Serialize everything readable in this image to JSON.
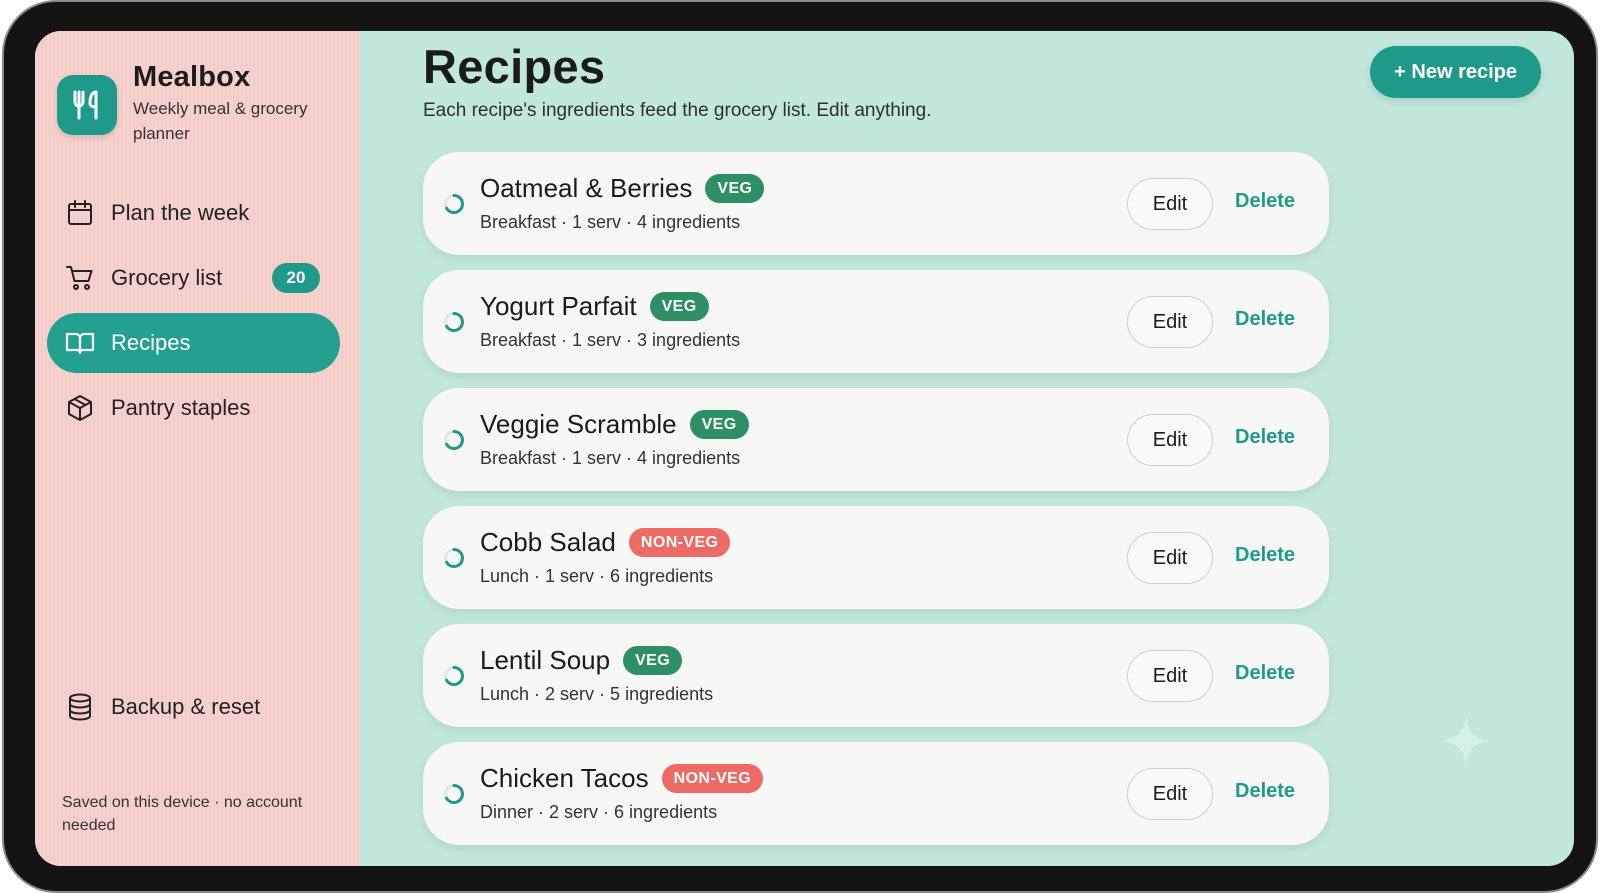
{
  "app": {
    "name": "Mealbox",
    "tagline": "Weekly meal & grocery planner",
    "accent": "#1f9a8a",
    "logo_icon": "fork-knife-icon"
  },
  "sidebar": {
    "items": [
      {
        "label": "Plan the week",
        "icon": "calendar-icon",
        "active": false
      },
      {
        "label": "Grocery list",
        "icon": "cart-icon",
        "badge": "20",
        "active": false
      },
      {
        "label": "Recipes",
        "icon": "book-icon",
        "active": true
      },
      {
        "label": "Pantry staples",
        "icon": "box-icon",
        "active": false
      }
    ],
    "backup": {
      "label": "Backup & reset",
      "icon": "database-icon"
    },
    "footnote": "Saved on this device · no account needed"
  },
  "main": {
    "title": "Recipes",
    "subtitle": "Each recipe's ingredients feed the grocery list. Edit anything.",
    "new_button": "+ New recipe",
    "edit_label": "Edit",
    "delete_label": "Delete",
    "recipes": [
      {
        "name": "Oatmeal & Berries",
        "tag": "VEG",
        "meta": "Breakfast · 1 serv · 4 ingredients"
      },
      {
        "name": "Yogurt Parfait",
        "tag": "VEG",
        "meta": "Breakfast · 1 serv · 3 ingredients"
      },
      {
        "name": "Veggie Scramble",
        "tag": "VEG",
        "meta": "Breakfast · 1 serv · 4 ingredients"
      },
      {
        "name": "Cobb Salad",
        "tag": "NON-VEG",
        "meta": "Lunch · 1 serv · 6 ingredients"
      },
      {
        "name": "Lentil Soup",
        "tag": "VEG",
        "meta": "Lunch · 2 serv · 5 ingredients"
      },
      {
        "name": "Chicken Tacos",
        "tag": "NON-VEG",
        "meta": "Dinner · 2 serv · 6 ingredients"
      }
    ]
  },
  "colors": {
    "veg": "#2e8f67",
    "nonveg": "#ee6b65",
    "sidebar_bg": "#f6d0cb",
    "main_bg": "#c2e7dc"
  }
}
